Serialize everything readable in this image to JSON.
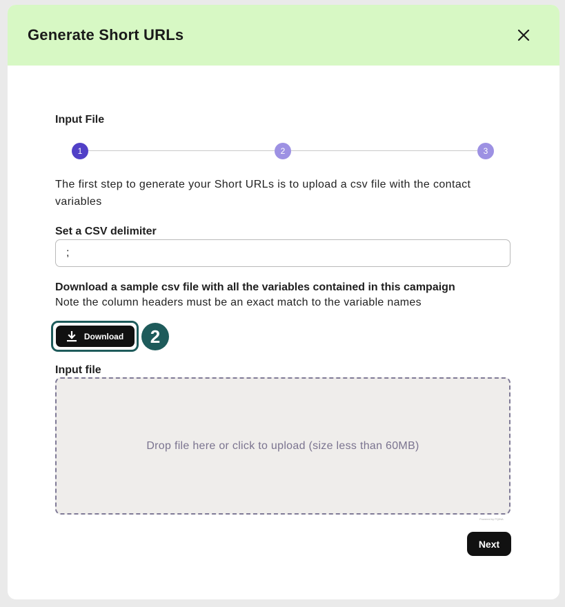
{
  "modal": {
    "title": "Generate Short URLs"
  },
  "step_section": {
    "title": "Input File",
    "steps": [
      "1",
      "2",
      "3"
    ],
    "active_step": 1
  },
  "intro_text": "The first step to generate your Short URLs is to upload a csv file with the contact variables",
  "delimiter": {
    "label": "Set a CSV delimiter",
    "value": ";"
  },
  "sample": {
    "title": "Download a sample csv file with all the variables contained in this campaign",
    "note": "Note the column headers must be an exact match to the variable names",
    "download_label": "Download",
    "badge": "2"
  },
  "upload": {
    "label": "Input file",
    "drop_text": "Drop file here or click to upload (size less than 60MB)",
    "powered_by": "Powered by PQINA"
  },
  "next_label": "Next",
  "colors": {
    "header_bg": "#d7f8c4",
    "step_active": "#5140c7",
    "step_pending": "#9d91e3",
    "highlight": "#1e5b5b"
  }
}
